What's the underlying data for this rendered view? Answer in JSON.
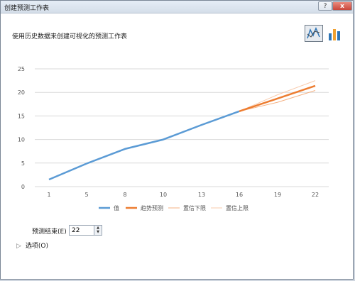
{
  "window": {
    "title": "创建预测工作表",
    "help_label": "?",
    "close_label": "x"
  },
  "description": "使用历史数据来创建可视化的预测工作表",
  "chart_types": [
    {
      "icon": "line-chart-icon",
      "selected": true
    },
    {
      "icon": "column-chart-icon",
      "selected": false
    }
  ],
  "chart_data": {
    "type": "line",
    "x_ticks": [
      "1",
      "5",
      "8",
      "10",
      "13",
      "16",
      "19",
      "22"
    ],
    "y_ticks": [
      "0",
      "5",
      "10",
      "15",
      "20",
      "25"
    ],
    "ylim": [
      0,
      25
    ],
    "grid": true,
    "legend_position": "bottom",
    "colors": {
      "value": "#5b9bd5",
      "forecast": "#ed7d31",
      "lower": "#f4b183",
      "upper": "#f8cbad"
    },
    "series": [
      {
        "name": "值",
        "key": "value",
        "x": [
          1,
          5,
          8,
          10,
          13,
          16
        ],
        "y": [
          1.5,
          4.9,
          8.0,
          10.0,
          13.1,
          16.0
        ]
      },
      {
        "name": "趋势预测",
        "key": "forecast",
        "x": [
          16,
          19,
          22
        ],
        "y": [
          16.0,
          18.7,
          21.4
        ]
      },
      {
        "name": "置信下限",
        "key": "lower",
        "x": [
          16,
          19,
          22
        ],
        "y": [
          16.0,
          17.9,
          20.4
        ]
      },
      {
        "name": "置信上限",
        "key": "upper",
        "x": [
          16,
          19,
          22
        ],
        "y": [
          16.0,
          19.5,
          22.5
        ]
      }
    ]
  },
  "forecast_end": {
    "label": "预测结束(E)",
    "value": "22"
  },
  "options_label": "选项(O)"
}
